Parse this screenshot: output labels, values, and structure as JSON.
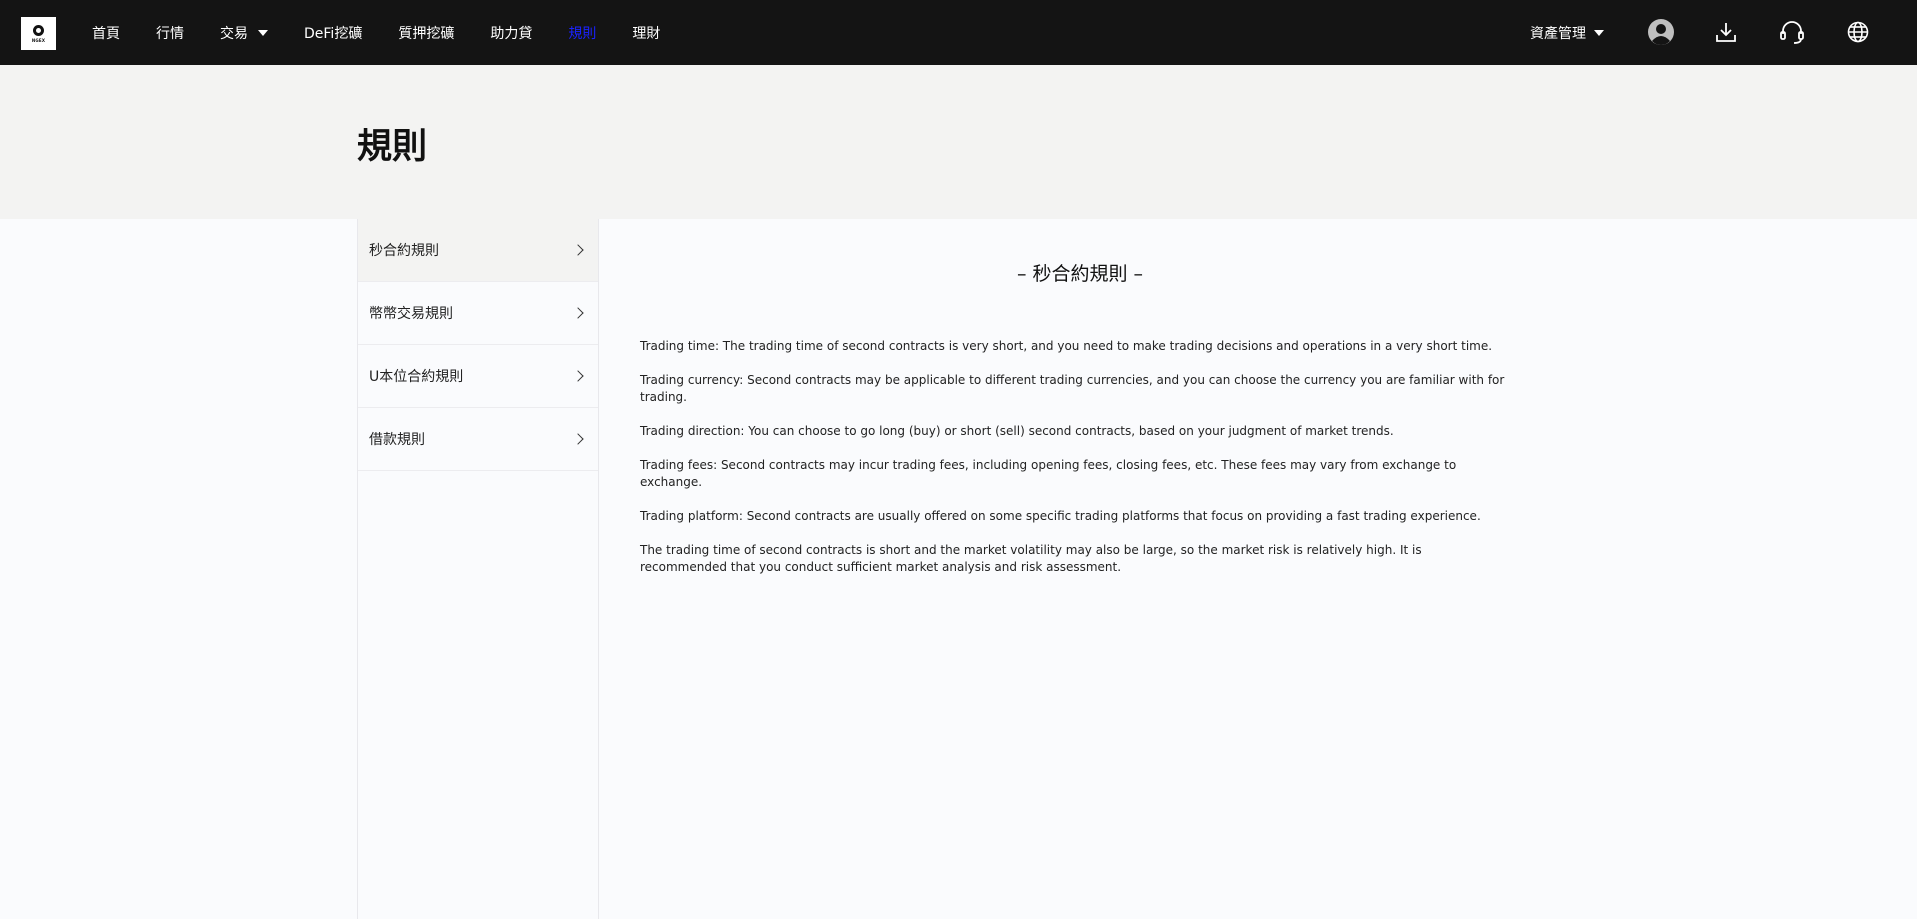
{
  "logo": {
    "text": "NGEX"
  },
  "nav": {
    "items": [
      {
        "label": "首頁",
        "active": false,
        "dropdown": false
      },
      {
        "label": "行情",
        "active": false,
        "dropdown": false
      },
      {
        "label": "交易",
        "active": false,
        "dropdown": true
      },
      {
        "label": "DeFi挖礦",
        "active": false,
        "dropdown": false
      },
      {
        "label": "質押挖礦",
        "active": false,
        "dropdown": false
      },
      {
        "label": "助力貸",
        "active": false,
        "dropdown": false
      },
      {
        "label": "規則",
        "active": true,
        "dropdown": false
      },
      {
        "label": "理財",
        "active": false,
        "dropdown": false
      }
    ],
    "active_color": "#1a22ff"
  },
  "header_right": {
    "asset_label": "資產管理",
    "icons": [
      "user-avatar-icon",
      "download-icon",
      "headset-icon",
      "globe-icon"
    ]
  },
  "hero": {
    "title": "規則"
  },
  "sidebar": {
    "items": [
      {
        "label": "秒合約規則",
        "selected": true
      },
      {
        "label": "幣幣交易規則",
        "selected": false
      },
      {
        "label": "U本位合約規則",
        "selected": false
      },
      {
        "label": "借款規則",
        "selected": false
      }
    ]
  },
  "content": {
    "title": "– 秒合約規則 –",
    "paragraphs": [
      "Trading time: The trading time of second contracts is very short, and you need to make trading decisions and operations in a very short time.",
      "Trading currency: Second contracts may be applicable to different trading currencies, and you can choose the currency you are familiar with for trading.",
      "Trading direction: You can choose to go long (buy) or short (sell) second contracts, based on your judgment of market trends.",
      "Trading fees: Second contracts may incur trading fees, including opening fees, closing fees, etc. These fees may vary from exchange to exchange.",
      "Trading platform: Second contracts are usually offered on some specific trading platforms that focus on providing a fast trading experience.",
      "The trading time of second contracts is short and the market volatility may also be large, so the market risk is relatively high. It is recommended that you conduct sufficient market analysis and risk assessment."
    ]
  }
}
